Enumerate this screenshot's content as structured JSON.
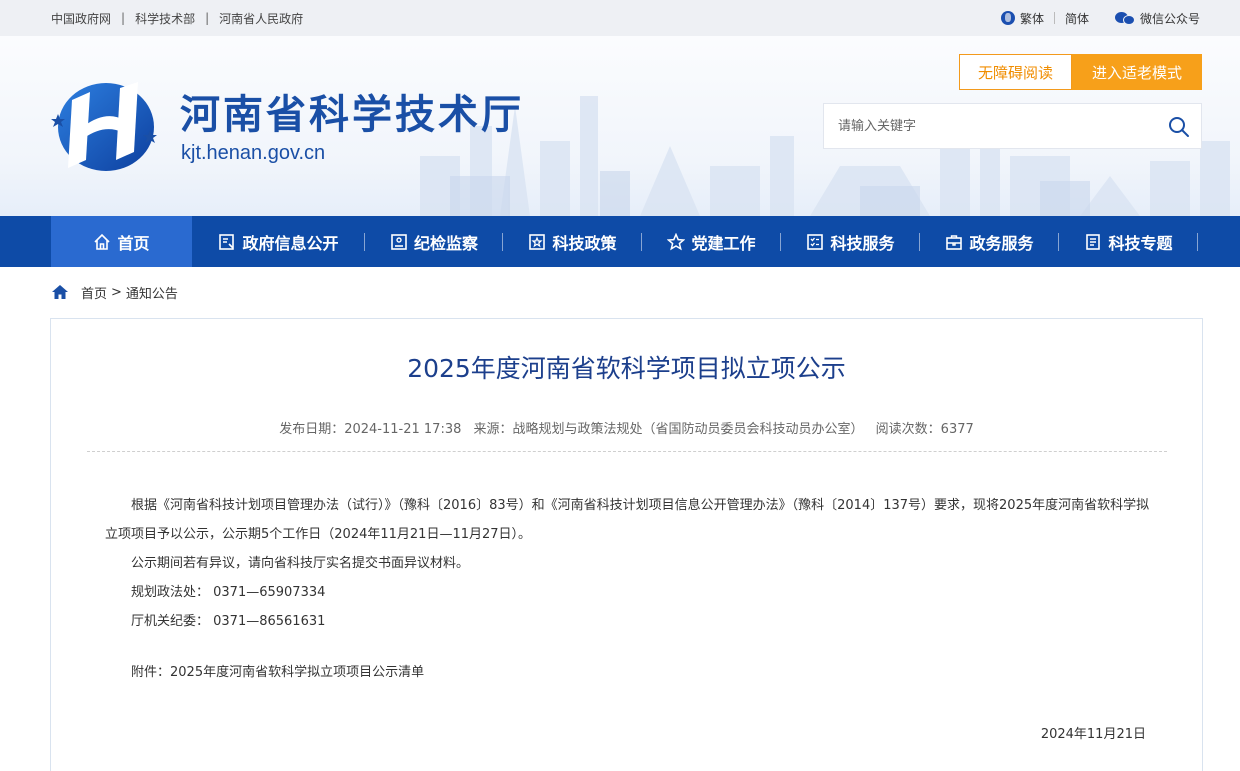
{
  "topbar": {
    "links": [
      "中国政府网",
      "科学技术部",
      "河南省人民政府"
    ],
    "separator": "|",
    "traditional": "繁体",
    "simplified": "简体",
    "wechat": "微信公众号"
  },
  "header": {
    "site_title": "河南省科学技术厅",
    "site_domain": "kjt.henan.gov.cn",
    "accessibility_btn": "无障碍阅读",
    "elder_mode_btn": "进入适老模式",
    "search_placeholder": "请输入关键字"
  },
  "nav": {
    "items": [
      {
        "label": "首页",
        "icon": "home-icon",
        "active": true
      },
      {
        "label": "政府信息公开",
        "icon": "info-disclosure-icon"
      },
      {
        "label": "纪检监察",
        "icon": "supervision-icon"
      },
      {
        "label": "科技政策",
        "icon": "policy-icon"
      },
      {
        "label": "党建工作",
        "icon": "star-icon"
      },
      {
        "label": "科技服务",
        "icon": "checklist-icon"
      },
      {
        "label": "政务服务",
        "icon": "briefcase-icon"
      },
      {
        "label": "科技专题",
        "icon": "document-icon"
      }
    ]
  },
  "breadcrumb": {
    "home": "首页",
    "separator": ">",
    "current": "通知公告"
  },
  "article": {
    "title": "2025年度河南省软科学项目拟立项公示",
    "meta": {
      "date": "发布日期：2024-11-21 17:38",
      "source": "来源：战略规划与政策法规处（省国防动员委员会科技动员办公室）",
      "views": "阅读次数：6377"
    },
    "paragraphs": [
      "根据《河南省科技计划项目管理办法（试行）》（豫科〔2016〕83号）和《河南省科技计划项目信息公开管理办法》（豫科〔2014〕137号）要求，现将2025年度河南省软科学拟立项项目予以公示，公示期5个工作日（2024年11月21日—11月27日）。",
      "公示期间若有异议，请向省科技厅实名提交书面异议材料。",
      "规划政法处： 0371—65907334",
      "厅机关纪委： 0371—86561631"
    ],
    "attachment": "附件：2025年度河南省软科学拟立项项目公示清单",
    "sign_date": "2024年11月21日"
  },
  "colors": {
    "nav_bg": "#0e4ba7",
    "nav_active": "#2a6ad0",
    "title_blue": "#1a4fa6",
    "accent_orange": "#f7a01a"
  }
}
